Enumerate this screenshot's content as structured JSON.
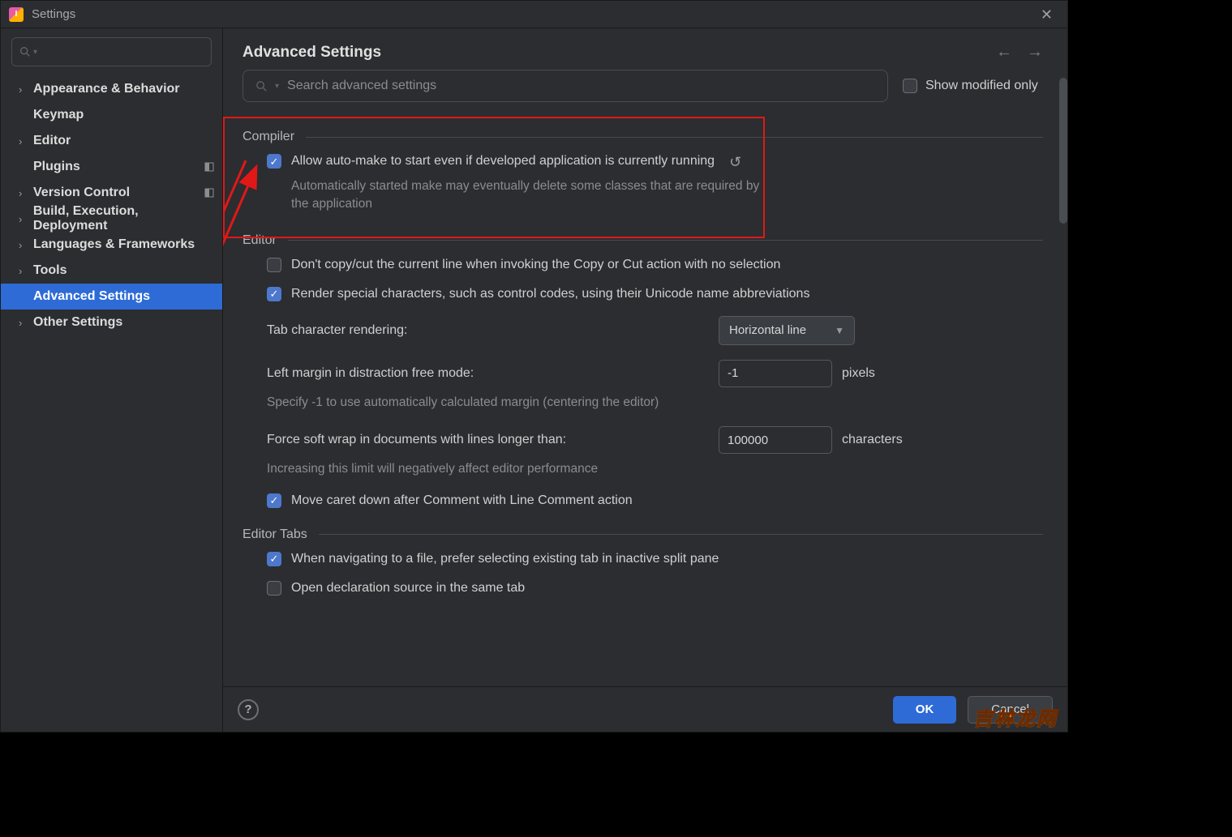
{
  "window": {
    "title": "Settings"
  },
  "sidebar": {
    "items": [
      {
        "label": "Appearance & Behavior",
        "expandable": true
      },
      {
        "label": "Keymap",
        "expandable": false
      },
      {
        "label": "Editor",
        "expandable": true
      },
      {
        "label": "Plugins",
        "expandable": false,
        "indicator": true
      },
      {
        "label": "Version Control",
        "expandable": true,
        "indicator": true
      },
      {
        "label": "Build, Execution, Deployment",
        "expandable": true
      },
      {
        "label": "Languages & Frameworks",
        "expandable": true
      },
      {
        "label": "Tools",
        "expandable": true
      },
      {
        "label": "Advanced Settings",
        "expandable": false,
        "selected": true
      },
      {
        "label": "Other Settings",
        "expandable": true
      }
    ]
  },
  "main": {
    "title": "Advanced Settings",
    "search_placeholder": "Search advanced settings",
    "show_modified_only": "Show modified only",
    "sections": {
      "compiler": {
        "title": "Compiler",
        "auto_make": {
          "label": "Allow auto-make to start even if developed application is currently running",
          "desc": "Automatically started make may eventually delete some classes that are required by the application",
          "checked": true
        }
      },
      "editor": {
        "title": "Editor",
        "dont_copy": {
          "label": "Don't copy/cut the current line when invoking the Copy or Cut action with no selection",
          "checked": false
        },
        "render_special": {
          "label": "Render special characters, such as control codes, using their Unicode name abbreviations",
          "checked": true
        },
        "tab_rendering": {
          "label": "Tab character rendering:",
          "value": "Horizontal line"
        },
        "left_margin": {
          "label": "Left margin in distraction free mode:",
          "value": "-1",
          "suffix": "pixels",
          "desc": "Specify -1 to use automatically calculated margin (centering the editor)"
        },
        "soft_wrap": {
          "label": "Force soft wrap in documents with lines longer than:",
          "value": "100000",
          "suffix": "characters",
          "desc": "Increasing this limit will negatively affect editor performance"
        },
        "move_caret": {
          "label": "Move caret down after Comment with Line Comment action",
          "checked": true
        }
      },
      "editor_tabs": {
        "title": "Editor Tabs",
        "prefer_existing": {
          "label": "When navigating to a file, prefer selecting existing tab in inactive split pane",
          "checked": true
        },
        "open_decl": {
          "label": "Open declaration source in the same tab",
          "checked": false
        }
      }
    }
  },
  "footer": {
    "ok": "OK",
    "cancel": "Cancel"
  },
  "watermark": "吉林龙网"
}
